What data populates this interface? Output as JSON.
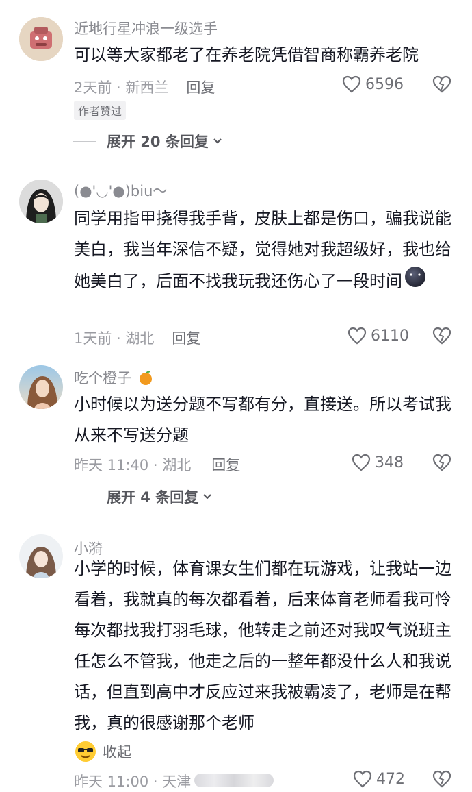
{
  "comments": [
    {
      "nickname": "近地行星冲浪一级选手",
      "text": "可以等大家都老了在养老院凭借智商称霸养老院",
      "time_location": "2天前 · 新西兰",
      "reply_label": "回复",
      "likes": "6596",
      "author_liked_badge": "作者赞过",
      "expand_label": "展开 20 条回复"
    },
    {
      "nickname": "(●'◡'●)biu～",
      "text": "同学用指甲挠得我手背，皮肤上都是伤口，骗我说能美白，我当年深信不疑，觉得她对我超级好，我也给她美白了，后面不找我玩我还伤心了一段时间",
      "emoji": "dark-round-face-emoji",
      "time_location": "1天前 · 湖北",
      "reply_label": "回复",
      "likes": "6110"
    },
    {
      "nickname": "吃个橙子",
      "nickname_emoji": "orange-emoji",
      "text": "小时候以为送分题不写都有分，直接送。所以考试我从来不写送分题",
      "time_location": "昨天 11:40 · 湖北",
      "reply_label": "回复",
      "likes": "348",
      "expand_label": "展开 4 条回复"
    },
    {
      "nickname": "小漪",
      "text": "小学的时候，体育课女生们都在玩游戏，让我站一边看着，我就真的每次都看着，后来体育老师看我可怜每次都找我打羽毛球，他转走之前还对我叹气说班主任怎么不管我，他走之后的一整年都没什么人和我说话，但直到高中才反应过来我被霸凌了，老师是在帮我，真的很感谢那个老师",
      "collapse_label": "收起",
      "collapse_emoji": "cool-sunglasses-emoji",
      "time_location": "昨天 11:00 · 天津",
      "likes": "472"
    }
  ],
  "colors": {
    "text": "#161823",
    "secondary": "#8a8b91",
    "icon": "#6e6f75"
  }
}
